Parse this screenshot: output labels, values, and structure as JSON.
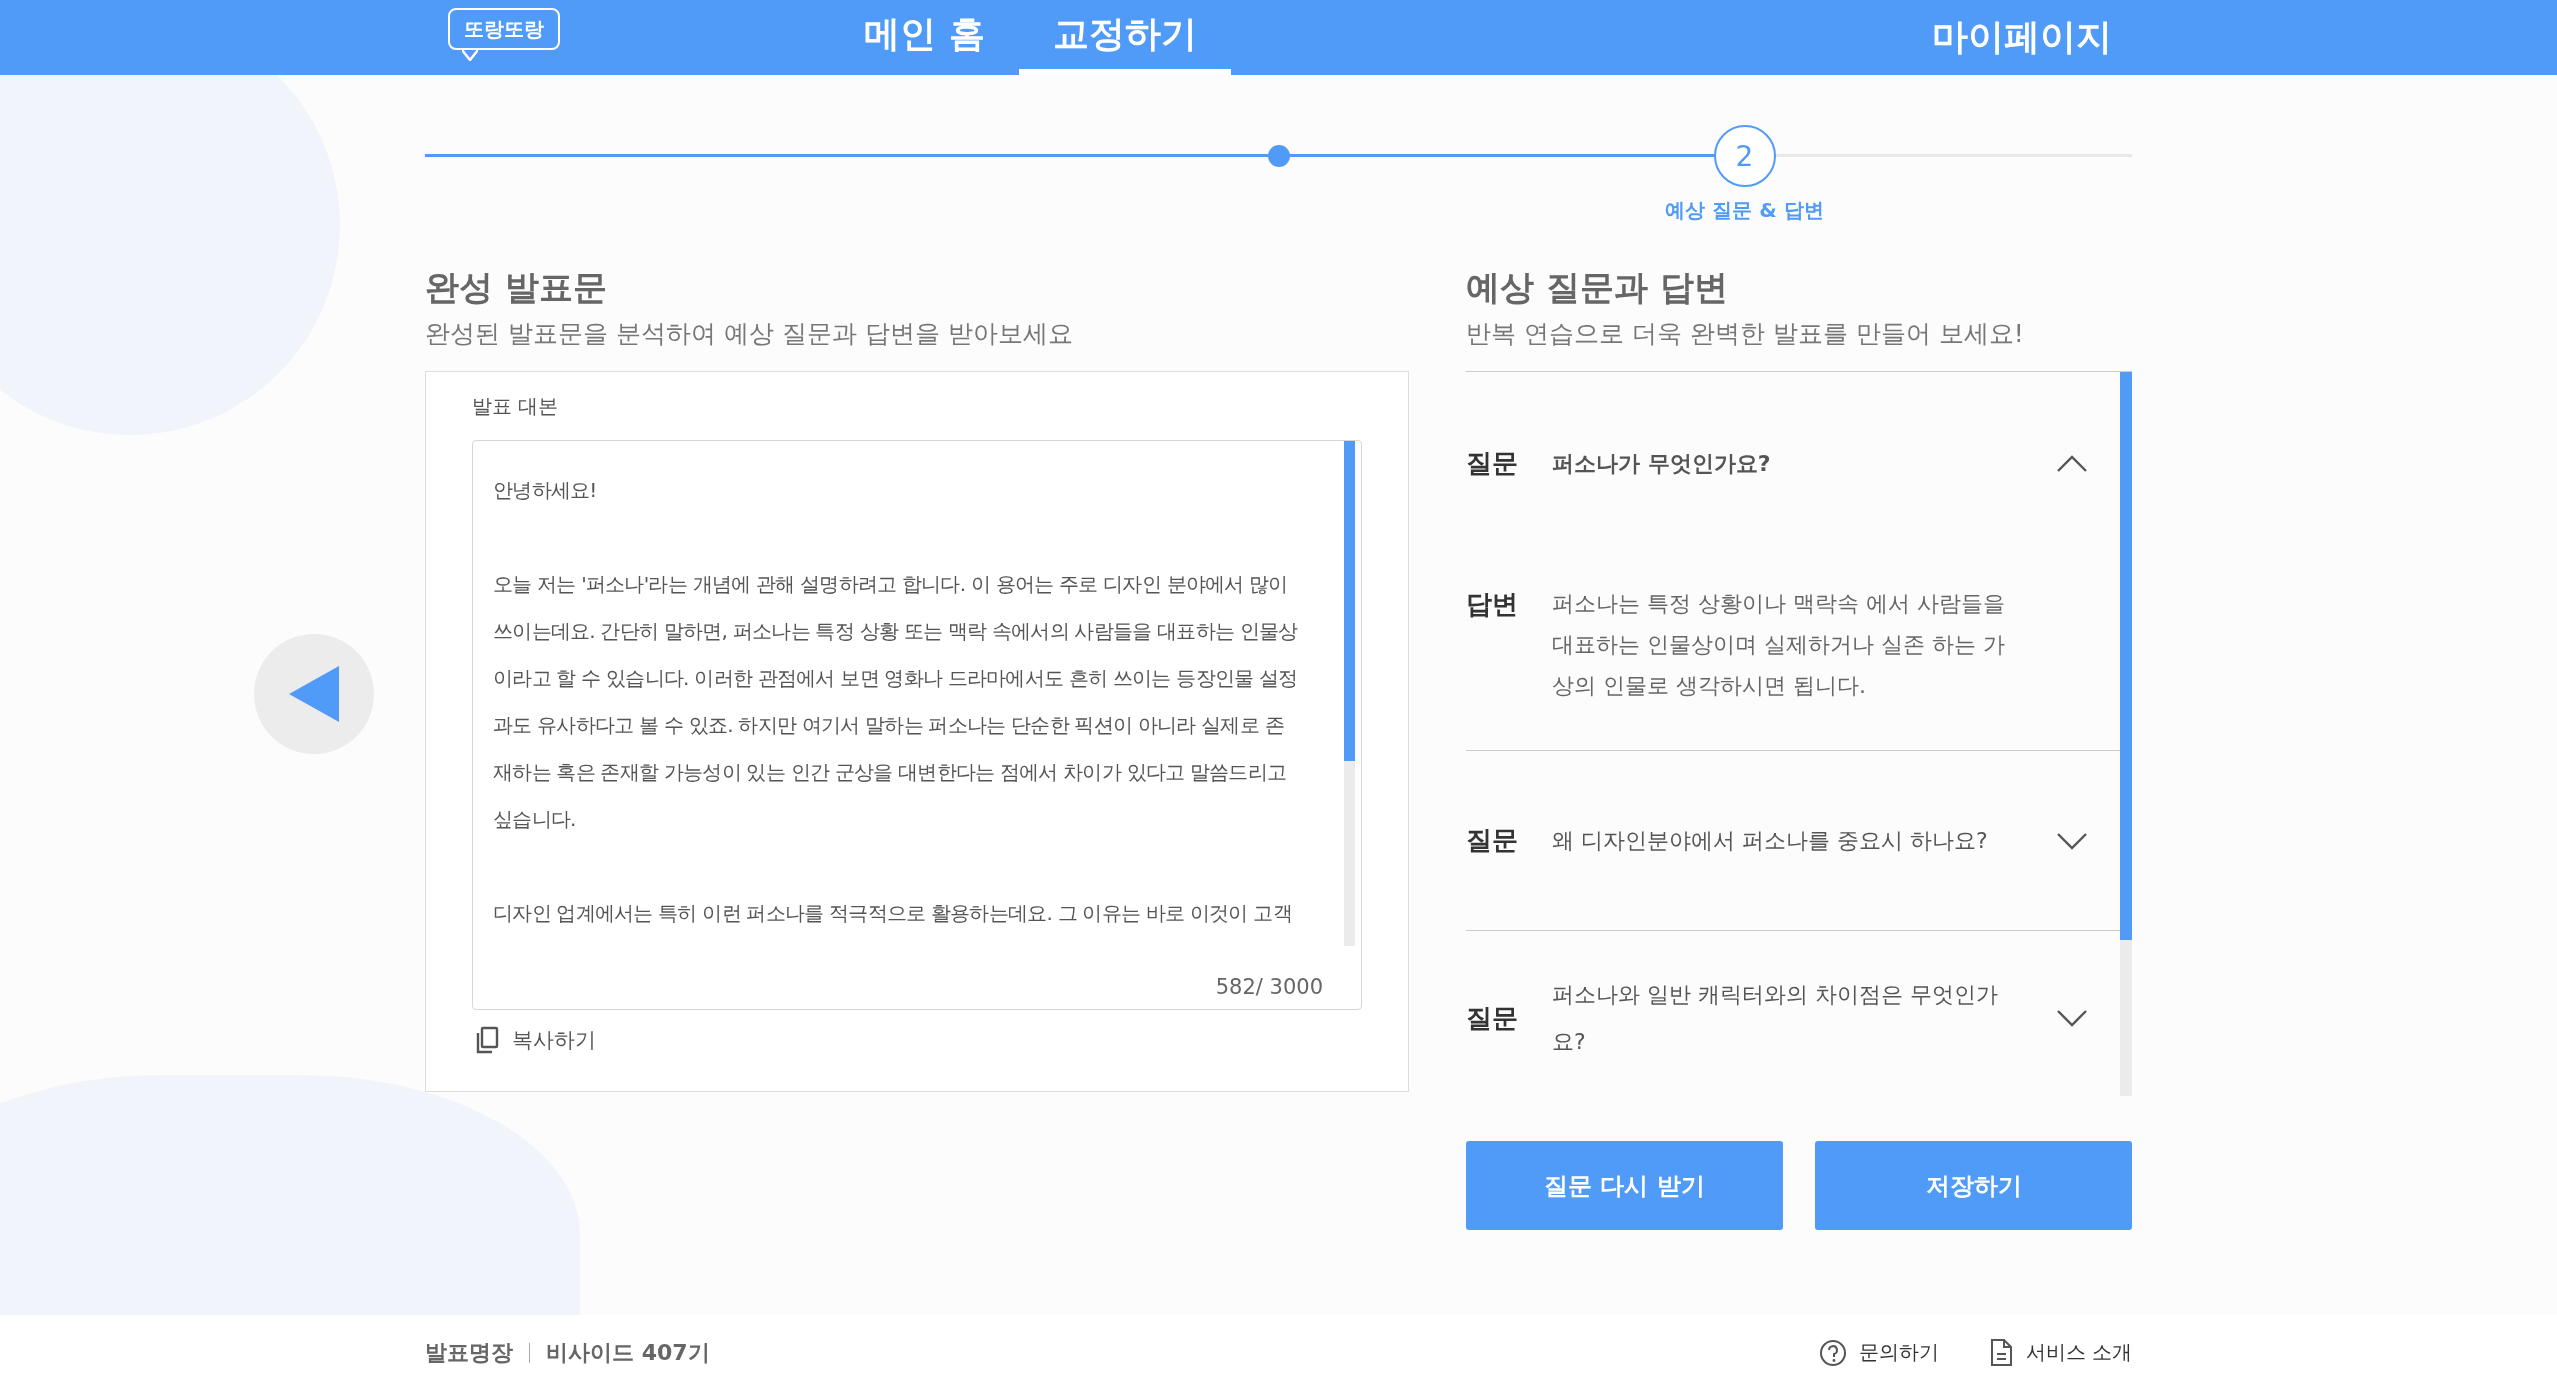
{
  "header": {
    "logo": "또랑또랑",
    "nav": [
      {
        "label": "메인 홈",
        "selected": false
      },
      {
        "label": "교정하기",
        "selected": true
      }
    ],
    "mypage": "마이페이지"
  },
  "progress": {
    "level": 0.773,
    "step_number": "2",
    "step_label": "예상 질문 & 답변"
  },
  "script_panel": {
    "title": "완성 발표문",
    "subtitle": "완성된 발표문을 분석하여 예상 질문과 답변을 받아보세요",
    "field_label": "발표 대본",
    "paragraphs": [
      "안녕하세요!",
      "오늘 저는 '퍼소나'라는 개념에 관해 설명하려고 합니다. 이 용어는 주로 디자인 분야에서 많이 쓰이는데요. 간단히 말하면, 퍼소나는 특정 상황 또는 맥락 속에서의 사람들을 대표하는 인물상이라고 할 수 있습니다. 이러한 관점에서 보면 영화나 드라마에서도 흔히 쓰이는 등장인물 설정과도 유사하다고 볼 수 있죠. 하지만 여기서 말하는 퍼소나는 단순한 픽션이 아니라 실제로 존재하는 혹은 존재할 가능성이 있는 인간 군상을 대변한다는 점에서 차이가 있다고 말씀드리고 싶습니다.",
      "디자인 업계에서는 특히 이런 퍼소나를 적극적으로 활용하는데요. 그 이유는 바로 이것이 고객"
    ],
    "counter": "582/ 3000",
    "copy_label": "복사하기"
  },
  "qa_panel": {
    "title": "예상 질문과 답변",
    "subtitle": "반복 연습으로 더욱 완벽한 발표를 만들어 보세요!",
    "items": [
      {
        "question_tag": "질문",
        "question": "퍼소나가 무엇인가요?",
        "expanded": true,
        "answer_tag": "답변",
        "answer": "퍼소나는 특정 상황이나 맥락속 에서 사람들을 대표하는 인물상이며 실제하거나 실존 하는 가상의 인물로 생각하시면 됩니다."
      },
      {
        "question_tag": "질문",
        "question": "왜 디자인분야에서 퍼소나를 중요시 하나요?",
        "expanded": false
      },
      {
        "question_tag": "질문",
        "question": "퍼소나와 일반 캐릭터와의 차이점은 무엇인가요?",
        "expanded": false
      }
    ]
  },
  "buttons": [
    "질문 다시 받기",
    "저장하기"
  ],
  "footer": {
    "brand": "발표명장",
    "team": "비사이드 407기",
    "links": [
      {
        "kind": "help",
        "label": "문의하기"
      },
      {
        "kind": "document",
        "label": "서비스 소개"
      }
    ]
  }
}
